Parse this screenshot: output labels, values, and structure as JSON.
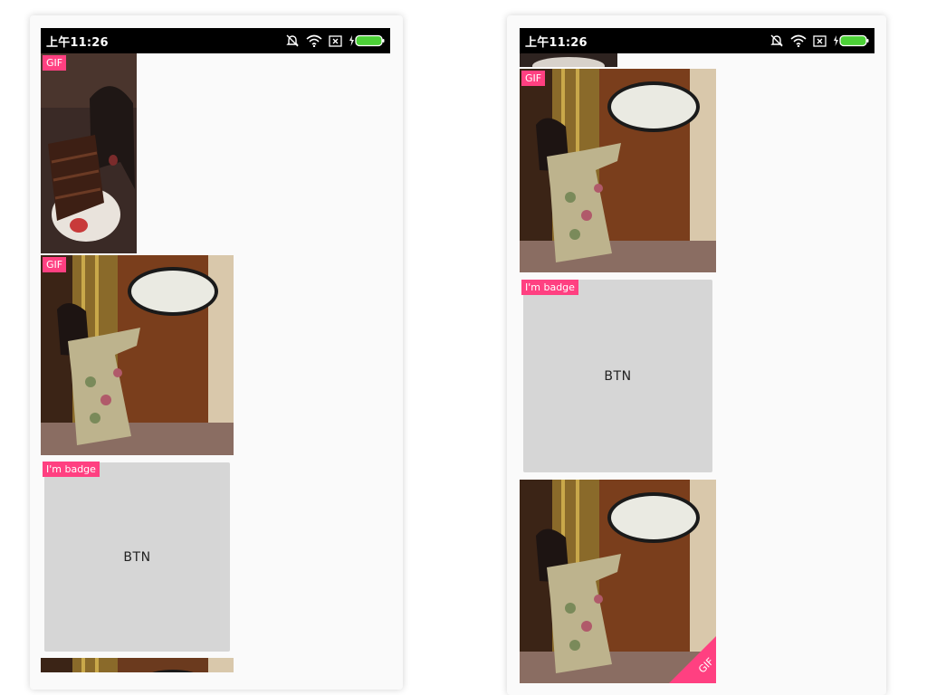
{
  "left_screen": {
    "status_time": "上午11:26",
    "items": {
      "cake_gif_badge": "GIF",
      "portrait_gif_badge": "GIF",
      "card_badge": "I'm badge",
      "card_button": "BTN"
    }
  },
  "right_screen": {
    "status_time": "上午11:26",
    "items": {
      "portrait_gif_badge": "GIF",
      "card_badge": "I'm badge",
      "card_button": "BTN",
      "corner_gif_badge": "GIF"
    }
  },
  "colors": {
    "badge": "#ff4081",
    "card": "#d6d6d6",
    "statusbar": "#000000",
    "battery": "#4cd137"
  },
  "icons": [
    "mute-icon",
    "wifi-icon",
    "sim-x-icon",
    "charging-icon",
    "battery-icon"
  ]
}
